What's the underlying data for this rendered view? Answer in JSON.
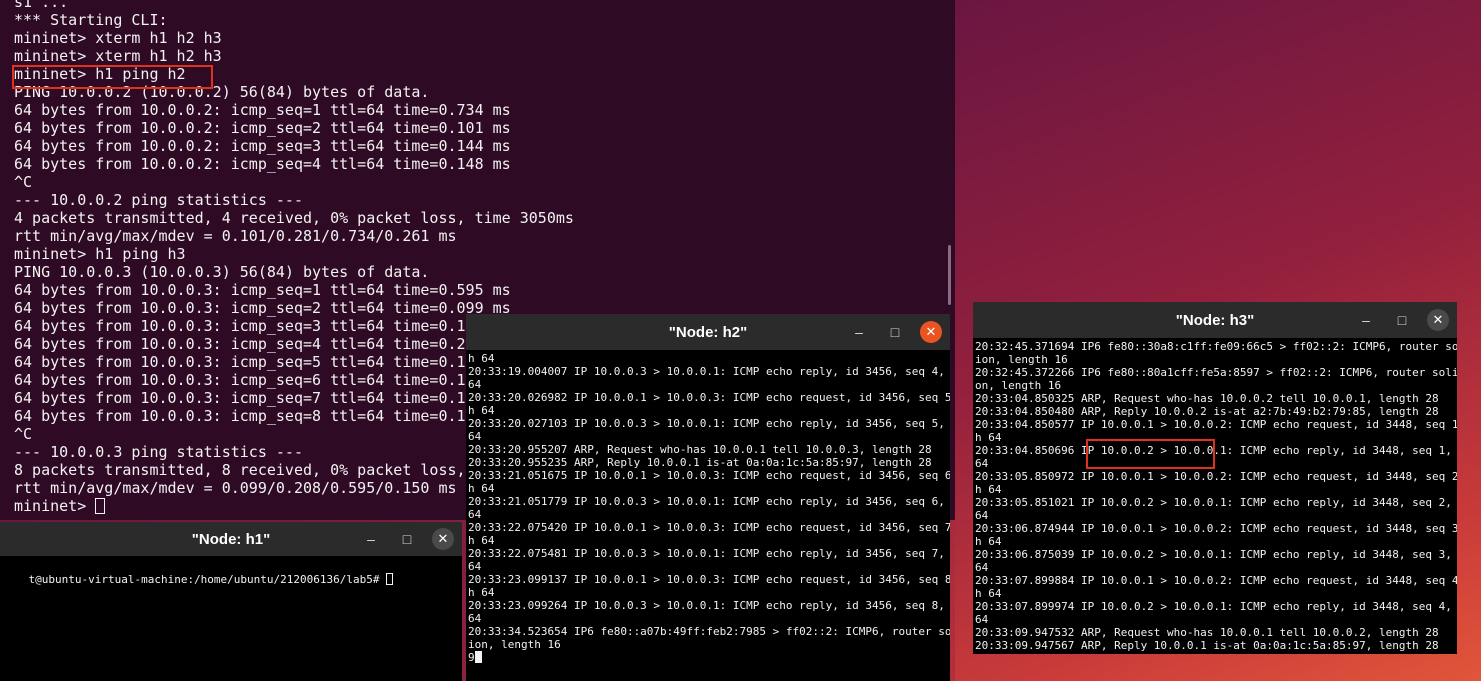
{
  "main_terminal": {
    "lines": [
      "s1 ...",
      "*** Starting CLI:",
      "mininet> xterm h1 h2 h3",
      "mininet> xterm h1 h2 h3",
      "mininet> h1 ping h2",
      "PING 10.0.0.2 (10.0.0.2) 56(84) bytes of data.",
      "64 bytes from 10.0.0.2: icmp_seq=1 ttl=64 time=0.734 ms",
      "64 bytes from 10.0.0.2: icmp_seq=2 ttl=64 time=0.101 ms",
      "64 bytes from 10.0.0.2: icmp_seq=3 ttl=64 time=0.144 ms",
      "64 bytes from 10.0.0.2: icmp_seq=4 ttl=64 time=0.148 ms",
      "^C",
      "--- 10.0.0.2 ping statistics ---",
      "4 packets transmitted, 4 received, 0% packet loss, time 3050ms",
      "rtt min/avg/max/mdev = 0.101/0.281/0.734/0.261 ms",
      "mininet> h1 ping h3",
      "PING 10.0.0.3 (10.0.0.3) 56(84) bytes of data.",
      "64 bytes from 10.0.0.3: icmp_seq=1 ttl=64 time=0.595 ms",
      "64 bytes from 10.0.0.3: icmp_seq=2 ttl=64 time=0.099 ms",
      "64 bytes from 10.0.0.3: icmp_seq=3 ttl=64 time=0.14",
      "64 bytes from 10.0.0.3: icmp_seq=4 ttl=64 time=0.20",
      "64 bytes from 10.0.0.3: icmp_seq=5 ttl=64 time=0.1",
      "64 bytes from 10.0.0.3: icmp_seq=6 ttl=64 time=0.1",
      "64 bytes from 10.0.0.3: icmp_seq=7 ttl=64 time=0.1",
      "64 bytes from 10.0.0.3: icmp_seq=8 ttl=64 time=0.1",
      "^C",
      "--- 10.0.0.3 ping statistics ---",
      "8 packets transmitted, 8 received, 0% packet loss,",
      "rtt min/avg/max/mdev = 0.099/0.208/0.595/0.150 ms"
    ],
    "prompt": "mininet> "
  },
  "h1": {
    "title": "\"Node: h1\"",
    "prompt_line": "t@ubuntu-virtual-machine:/home/ubuntu/212006136/lab5# "
  },
  "h2": {
    "title": "\"Node: h2\"",
    "lines": [
      "h 64",
      "20:33:19.004007 IP 10.0.0.3 > 10.0.0.1: ICMP echo reply, id 3456, seq 4, length",
      "64",
      "20:33:20.026982 IP 10.0.0.1 > 10.0.0.3: ICMP echo request, id 3456, seq 5, lengt",
      "h 64",
      "20:33:20.027103 IP 10.0.0.3 > 10.0.0.1: ICMP echo reply, id 3456, seq 5, length",
      "64",
      "20:33:20.955207 ARP, Request who-has 10.0.0.1 tell 10.0.0.3, length 28",
      "20:33:20.955235 ARP, Reply 10.0.0.1 is-at 0a:0a:1c:5a:85:97, length 28",
      "20:33:21.051675 IP 10.0.0.1 > 10.0.0.3: ICMP echo request, id 3456, seq 6, lengt",
      "h 64",
      "20:33:21.051779 IP 10.0.0.3 > 10.0.0.1: ICMP echo reply, id 3456, seq 6, length",
      "64",
      "20:33:22.075420 IP 10.0.0.1 > 10.0.0.3: ICMP echo request, id 3456, seq 7, lengt",
      "h 64",
      "20:33:22.075481 IP 10.0.0.3 > 10.0.0.1: ICMP echo reply, id 3456, seq 7, length",
      "64",
      "20:33:23.099137 IP 10.0.0.1 > 10.0.0.3: ICMP echo request, id 3456, seq 8, lengt",
      "h 64",
      "20:33:23.099264 IP 10.0.0.3 > 10.0.0.1: ICMP echo reply, id 3456, seq 8, length",
      "64",
      "20:33:34.523654 IP6 fe80::a07b:49ff:feb2:7985 > ff02::2: ICMP6, router solicitat",
      "ion, length 16"
    ],
    "last_line": "9"
  },
  "h3": {
    "title": "\"Node: h3\"",
    "lines": [
      "20:32:45.371694 IP6 fe80::30a8:c1ff:fe09:66c5 > ff02::2: ICMP6, router solicitat",
      "ion, length 16",
      "20:32:45.372266 IP6 fe80::80a1cff:fe5a:8597 > ff02::2: ICMP6, router solicitati",
      "on, length 16",
      "20:33:04.850325 ARP, Request who-has 10.0.0.2 tell 10.0.0.1, length 28",
      "20:33:04.850480 ARP, Reply 10.0.0.2 is-at a2:7b:49:b2:79:85, length 28",
      "20:33:04.850577 IP 10.0.0.1 > 10.0.0.2: ICMP echo request, id 3448, seq 1, lengt",
      "h 64",
      "20:33:04.850696 IP 10.0.0.2 > 10.0.0.1: ICMP echo reply, id 3448, seq 1, length",
      "64",
      "20:33:05.850972 IP 10.0.0.1 > 10.0.0.2: ICMP echo request, id 3448, seq 2, lengt",
      "h 64",
      "20:33:05.851021 IP 10.0.0.2 > 10.0.0.1: ICMP echo reply, id 3448, seq 2, length",
      "64",
      "20:33:06.874944 IP 10.0.0.1 > 10.0.0.2: ICMP echo request, id 3448, seq 3, lengt",
      "h 64",
      "20:33:06.875039 IP 10.0.0.2 > 10.0.0.1: ICMP echo reply, id 3448, seq 3, length",
      "64",
      "20:33:07.899884 IP 10.0.0.1 > 10.0.0.2: ICMP echo request, id 3448, seq 4, lengt",
      "h 64",
      "20:33:07.899974 IP 10.0.0.2 > 10.0.0.1: ICMP echo reply, id 3448, seq 4, length",
      "64",
      "20:33:09.947532 ARP, Request who-has 10.0.0.1 tell 10.0.0.2, length 28",
      "20:33:09.947567 ARP, Reply 10.0.0.1 is-at 0a:0a:1c:5a:85:97, length 28"
    ]
  },
  "window_controls": {
    "minimize": "–",
    "maximize": "□",
    "close": "✕"
  }
}
